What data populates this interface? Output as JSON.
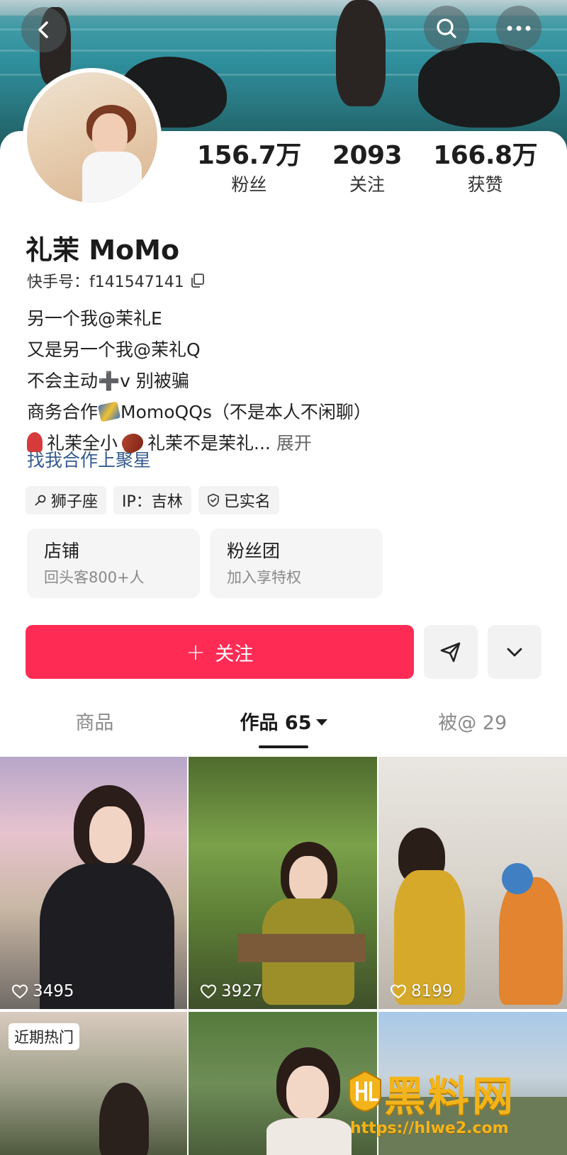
{
  "header": {
    "back_icon": "chevron-left-icon",
    "search_icon": "search-icon",
    "more_icon": "ellipsis-icon"
  },
  "stats": [
    {
      "value": "156.7万",
      "label": "粉丝"
    },
    {
      "value": "2093",
      "label": "关注"
    },
    {
      "value": "166.8万",
      "label": "获赞"
    }
  ],
  "profile": {
    "name": "礼茉 MoMo",
    "kuaishou_id": "快手号：f141547141",
    "bio_lines": [
      "另一个我@茉礼E",
      "又是另一个我@茉礼Q",
      "不会主动➕v  别被骗",
      "MomoQQs（不是本人不闲聊）"
    ],
    "bio_prefix_business": "商务合作",
    "bio_last_a": "礼茉全小",
    "bio_last_b": "礼茉不是茉礼...",
    "expand_label": "展开",
    "link_text": "找我合作上聚星"
  },
  "tags": [
    {
      "icon": "search-key-icon",
      "label": "狮子座"
    },
    {
      "icon": "",
      "label": "IP：吉林"
    },
    {
      "icon": "shield-check-icon",
      "label": "已实名"
    }
  ],
  "features": [
    {
      "title": "店铺",
      "subtitle": "回头客800+人"
    },
    {
      "title": "粉丝团",
      "subtitle": "加入享特权"
    }
  ],
  "actions": {
    "follow_label": "关注",
    "share_icon": "send-icon",
    "dropdown_icon": "chevron-down-icon",
    "accent": "#fe2c55"
  },
  "tabs": [
    {
      "label": "商品",
      "active": false
    },
    {
      "label": "作品 65",
      "active": true
    },
    {
      "label": "被@ 29",
      "active": false
    }
  ],
  "grid": [
    {
      "likes": "3495"
    },
    {
      "likes": "3927"
    },
    {
      "likes": "8199"
    },
    {
      "badge": "近期热门"
    },
    {},
    {}
  ],
  "watermark": {
    "title": "黑料网",
    "url": "https://hlwe2.com"
  }
}
